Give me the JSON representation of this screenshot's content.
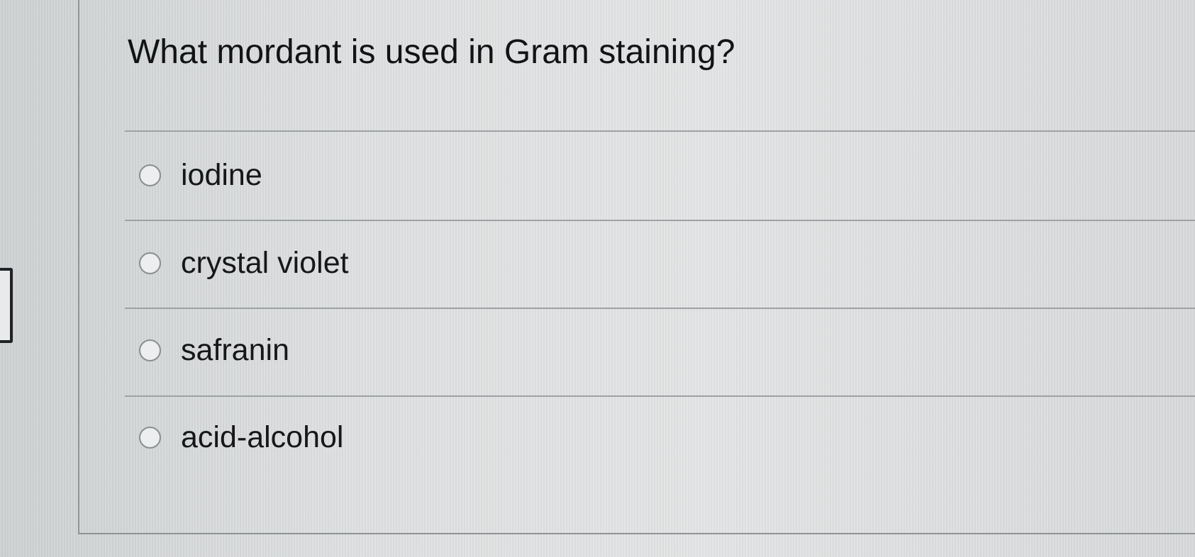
{
  "question": {
    "text": "What mordant is used in Gram staining?"
  },
  "options": [
    {
      "label": "iodine",
      "selected": false
    },
    {
      "label": "crystal violet",
      "selected": false
    },
    {
      "label": "safranin",
      "selected": false
    },
    {
      "label": "acid-alcohol",
      "selected": false
    }
  ]
}
